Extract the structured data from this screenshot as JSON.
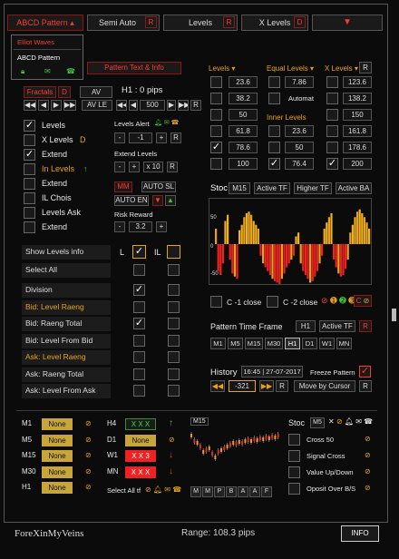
{
  "top_bar": {
    "pattern_select": "ABCD Pattern",
    "semi_auto": "Semi Auto",
    "semi_auto_badge": "R",
    "levels": "Levels",
    "levels_badge": "R",
    "x_levels": "X Levels",
    "x_levels_badge": "D"
  },
  "dropdown_menu": {
    "items": [
      "Elliot Waves",
      "ABCD Pattern"
    ]
  },
  "pattern_text_info": "Pattern Text & Info",
  "fractals": {
    "label": "Fractals",
    "d_btn": "D",
    "av": "AV",
    "tf": "H1 : 0  pips",
    "av_le": "AV LE",
    "value": "500",
    "r_btn": "R"
  },
  "left_checks": [
    {
      "label": "Levels",
      "checked": true,
      "suffix": ""
    },
    {
      "label": "X Levels",
      "checked": false,
      "suffix": "D"
    },
    {
      "label": "Extend",
      "checked": true,
      "suffix": ""
    },
    {
      "label": "In Levels",
      "checked": false,
      "suffix": "↑"
    },
    {
      "label": "Extend",
      "checked": false,
      "suffix": ""
    },
    {
      "label": "IL Chois",
      "checked": false,
      "suffix": ""
    },
    {
      "label": "Levels Ask",
      "checked": false,
      "suffix": ""
    },
    {
      "label": "Extend",
      "checked": false,
      "suffix": ""
    }
  ],
  "levels_alert": {
    "title": "Levels Alert",
    "value": "-1",
    "extend_title": "Extend Levels",
    "extend_value": "x 10",
    "mm": "MM",
    "auto_sl": "AUTO SL",
    "auto_en": "AUTO EN",
    "risk_title": "Risk Reward",
    "risk_value": "3.2"
  },
  "levels_headers": {
    "levels": "Levels",
    "equal": "Equal Levels",
    "x": "X Levels",
    "r": "R",
    "inner": "Inner Levels",
    "automat": "Automat"
  },
  "levels_col": [
    "23.6",
    "38.2",
    "50",
    "61.8",
    "78.6",
    "100"
  ],
  "equal_col": [
    "7.86"
  ],
  "inner_col": [
    "23.6",
    "50",
    "76.4"
  ],
  "x_col": [
    "123.6",
    "138.2",
    "150",
    "161.8",
    "178.6",
    "200"
  ],
  "stoc_tabs": {
    "stoc": "Stoc",
    "m15": "M15",
    "active_tf": "Active TF",
    "higher_tf": "Higher TF",
    "active_ba": "Active BA"
  },
  "hist_ticks": [
    "50",
    "0",
    "-50"
  ],
  "close_row": {
    "c1": "C -1 close",
    "c2": "C -2 close",
    "c_btn": "C"
  },
  "pattern_tf": {
    "title": "Pattern Time Frame",
    "h1": "H1",
    "active_tf": "Active TF",
    "r": "R",
    "tfs": [
      "M1",
      "M5",
      "M15",
      "M30",
      "H1",
      "D1",
      "W1",
      "MN"
    ]
  },
  "history": {
    "title": "History",
    "date": "16:45 | 27-07-2017",
    "freeze": "Freeze Pattern",
    "value": "-321",
    "move": "Move by Cursor",
    "r": "R"
  },
  "show_levels": {
    "label": "Show Levels info",
    "l": "L",
    "il": "IL"
  },
  "select_all": "Select All",
  "list_rows": [
    {
      "label": "Division",
      "orange": false,
      "checked": true
    },
    {
      "label": "Bid: Level Raeng",
      "orange": true,
      "checked": false
    },
    {
      "label": "Bid: Raeng Total",
      "orange": false,
      "checked": true
    },
    {
      "label": "Bid: Level From Bid",
      "orange": false,
      "checked": false
    },
    {
      "label": "Ask: Level Raeng",
      "orange": true,
      "checked": false
    },
    {
      "label": "Ask: Raeng Total",
      "orange": false,
      "checked": false
    },
    {
      "label": "Ask: Level From Ask",
      "orange": false,
      "checked": false
    }
  ],
  "bottom_tf_left": [
    {
      "tf": "M1",
      "status": "None"
    },
    {
      "tf": "M5",
      "status": "None"
    },
    {
      "tf": "M15",
      "status": "None"
    },
    {
      "tf": "M30",
      "status": "None"
    },
    {
      "tf": "H1",
      "status": "None"
    }
  ],
  "bottom_tf_mid": [
    {
      "tf": "H4",
      "status": "X X X",
      "kind": "green",
      "dir": "↑"
    },
    {
      "tf": "D1",
      "status": "None",
      "kind": "none",
      "dir": ""
    },
    {
      "tf": "W1",
      "status": "X X 3",
      "kind": "red",
      "dir": "↓"
    },
    {
      "tf": "MN",
      "status": "X X X",
      "kind": "red",
      "dir": "↓"
    }
  ],
  "select_all_tf": "Select All tf",
  "mini_tf": "M15",
  "pattern_letters": [
    "M",
    "M",
    "P",
    "B",
    "A",
    "A",
    "F"
  ],
  "stoc_panel": {
    "title": "Stoc",
    "tf": "M5",
    "options": [
      "Cross 50",
      "Signal Cross",
      "Value Up/Down",
      "Oposit Over B/S"
    ]
  },
  "footer": {
    "brand": "ForeXinMyVeins",
    "range": "Range: 108.3 pips",
    "info": "INFO"
  },
  "colors": {
    "orange": "#e8a21a",
    "red": "#ff3b30",
    "gold": "#c8a53a",
    "green": "#3ee03e"
  }
}
